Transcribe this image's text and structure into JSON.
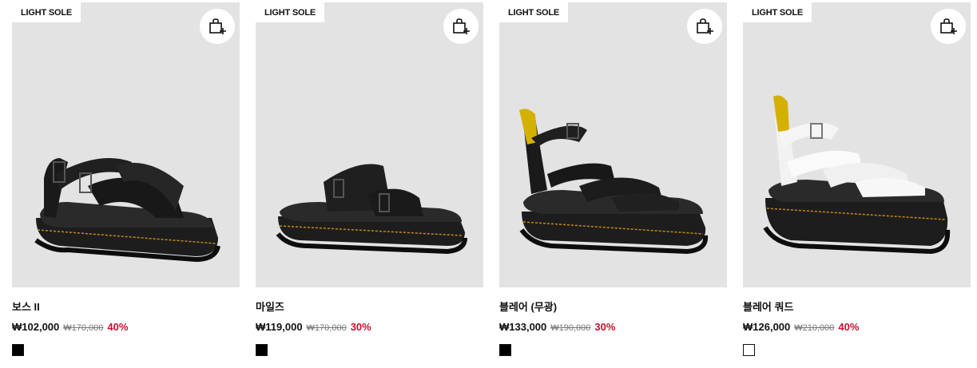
{
  "products": [
    {
      "badge": "LIGHT SOLE",
      "name": "보스 II",
      "price": "₩102,000",
      "original_price": "₩170,000",
      "discount": "40%",
      "swatch_color": "#000000",
      "image_desc": "black-strap-sandal"
    },
    {
      "badge": "LIGHT SOLE",
      "name": "마일즈",
      "price": "₩119,000",
      "original_price": "₩170,000",
      "discount": "30%",
      "swatch_color": "#000000",
      "image_desc": "black-slide-sandal"
    },
    {
      "badge": "LIGHT SOLE",
      "name": "블레어 (무광)",
      "price": "₩133,000",
      "original_price": "₩190,000",
      "discount": "30%",
      "swatch_color": "#000000",
      "image_desc": "black-ankle-strap-sandal"
    },
    {
      "badge": "LIGHT SOLE",
      "name": "블레어 쿼드",
      "price": "₩126,000",
      "original_price": "₩210,000",
      "discount": "40%",
      "swatch_color": "#ffffff",
      "image_desc": "white-platform-sandal"
    }
  ],
  "icons": {
    "cart": "add-to-cart-icon"
  },
  "colors": {
    "discount": "#c8102e",
    "image_bg": "#e3e3e3",
    "badge_bg": "#ffffff"
  }
}
